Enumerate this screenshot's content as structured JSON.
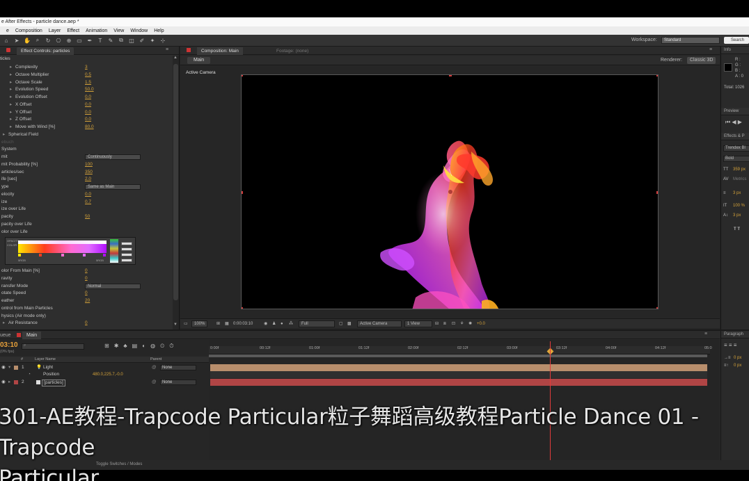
{
  "window": {
    "title": "e After Effects - particle dance.aep *"
  },
  "menu": [
    "e",
    "Composition",
    "Layer",
    "Effect",
    "Animation",
    "View",
    "Window",
    "Help"
  ],
  "toolbar": {
    "workspace_label": "Workspace:",
    "workspace_value": "Standard",
    "search_label": "Search"
  },
  "effect_controls": {
    "tab": "Effect Controls: particles",
    "section": "ticles",
    "rows": [
      {
        "label": "Complexity",
        "value": "3",
        "indent": 2
      },
      {
        "label": "Octave Multiplier",
        "value": "0.5",
        "indent": 2
      },
      {
        "label": "Octave Scale",
        "value": "1.5",
        "indent": 2
      },
      {
        "label": "Evolution Speed",
        "value": "50.0",
        "indent": 2
      },
      {
        "label": "Evolution Offset",
        "value": "0.0",
        "indent": 2
      },
      {
        "label": "X Offset",
        "value": "0.0",
        "indent": 2
      },
      {
        "label": "Y Offset",
        "value": "0.0",
        "indent": 2
      },
      {
        "label": "Z Offset",
        "value": "0.0",
        "indent": 2
      },
      {
        "label": "Move with Wind [%]",
        "value": "80.0",
        "indent": 2
      },
      {
        "label": "Spherical Field",
        "value": "",
        "indent": 1
      },
      {
        "label": "ebuch",
        "value": "",
        "indent": 0,
        "dim": true
      },
      {
        "label": "System",
        "value": "",
        "indent": 0
      },
      {
        "label": "mit",
        "value": "",
        "select": "Continuously",
        "indent": 0
      },
      {
        "label": "mit Probability [%]",
        "value": "100",
        "indent": 0
      },
      {
        "label": "articles/sec",
        "value": "350",
        "indent": 0
      },
      {
        "label": "ife [sec]",
        "value": "2.0",
        "indent": 0
      },
      {
        "label": "ype",
        "value": "",
        "select": "Same as Main",
        "indent": 0
      },
      {
        "label": "elocity",
        "value": "0.0",
        "indent": 0
      },
      {
        "label": "ize",
        "value": "0.7",
        "indent": 0
      },
      {
        "label": "ize over Life",
        "value": "",
        "indent": 0
      },
      {
        "label": "pacity",
        "value": "50",
        "indent": 0
      },
      {
        "label": "pacity over Life",
        "value": "",
        "indent": 0
      },
      {
        "label": "olor over Life",
        "value": "",
        "indent": 0
      }
    ],
    "rows_after": [
      {
        "label": "olor From Main [%]",
        "value": "0",
        "indent": 0
      },
      {
        "label": "ravity",
        "value": "0",
        "indent": 0
      },
      {
        "label": "ransfer Mode",
        "value": "",
        "select": "Normal",
        "indent": 0
      },
      {
        "label": "otate Speed",
        "value": "0",
        "indent": 0
      },
      {
        "label": "eather",
        "value": "20",
        "indent": 0
      },
      {
        "label": "ontrol from Main Particles",
        "value": "",
        "indent": 0
      },
      {
        "label": "hysics (Air mode only)",
        "value": "",
        "indent": 0
      },
      {
        "label": "Air Resistance",
        "value": "0",
        "indent": 1
      }
    ],
    "gradient_labels": {
      "opacity": "OPACITY",
      "color": "COLOR",
      "left": "5RGB",
      "right": "5RGB"
    }
  },
  "composition": {
    "tab": "Composition: Main",
    "footage_tab": "Footage: (none)",
    "main_button": "Main",
    "renderer_label": "Renderer:",
    "renderer_value": "Classic 3D",
    "active_camera": "Active Camera",
    "zoom": "100%",
    "timecode": "0:00:03:10",
    "resolution": "Full",
    "camera_view": "Active Camera",
    "views": "1 View",
    "exposure": "+0.0"
  },
  "right_panel": {
    "info_tab": "Info",
    "info_r": "R :",
    "info_g": "G :",
    "info_b": "B :",
    "info_a": "A : 0",
    "total": "Total: 1026",
    "preview_tab": "Preview",
    "effects_tab": "Effects & P",
    "font": "Trendex Bl",
    "style": "Bold",
    "size": "359 px",
    "tracking": "Metrics",
    "stroke": "3 px",
    "scale": "100 %",
    "baseline": "3 px",
    "paragraph_tab": "Paragraph",
    "para_1": "0 px",
    "para_2": "0 px"
  },
  "timeline": {
    "tab_left": "ueue",
    "tab_main": "Main",
    "timecode": "03:10",
    "fps": "(0% fps)",
    "col_layer": "Layer Name",
    "col_parent": "Parent",
    "layers": [
      {
        "num": "1",
        "name": "Light",
        "parent": "None",
        "bar_color": "#b88e6c"
      },
      {
        "num": "",
        "name": "Position",
        "value": "480.0,225.7,-0.0",
        "parent": "",
        "bar_color": ""
      },
      {
        "num": "2",
        "name": "[particles]",
        "parent": "None",
        "bar_color": "#b04545"
      }
    ],
    "ticks": [
      "0:00f",
      "00:12f",
      "01:00f",
      "01:12f",
      "02:00f",
      "02:12f",
      "03:00f",
      "03:12f",
      "04:00f",
      "04:12f",
      "05:0"
    ],
    "toggle_label": "Toggle Switches / Modes"
  },
  "subtitle": "301-AE教程-Trapcode Particular粒子舞蹈高级教程Particle Dance 01 - Trapcode\nParticular"
}
